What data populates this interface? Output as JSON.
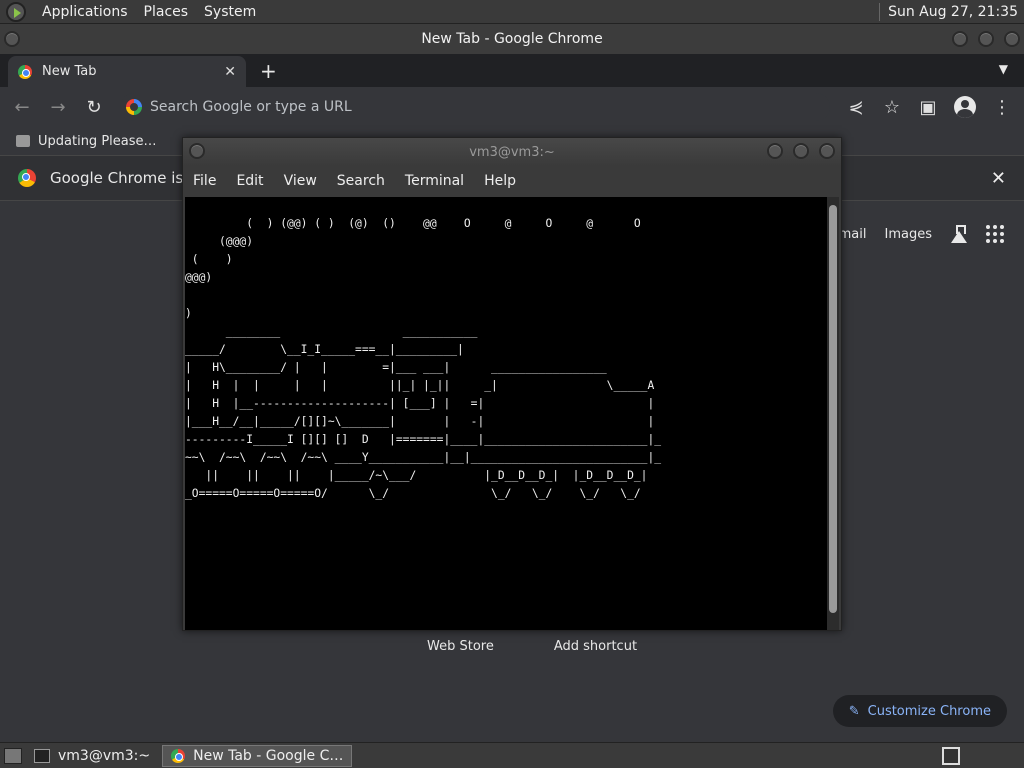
{
  "system_panel": {
    "menus": [
      "Applications",
      "Places",
      "System"
    ],
    "clock": "Sun Aug 27, 21:35"
  },
  "chrome": {
    "window_title": "New Tab - Google Chrome",
    "tab": {
      "title": "New Tab",
      "close": "✕"
    },
    "omnibox_placeholder": "Search Google or type a URL",
    "bookmark": "Updating Please…",
    "infobar_text": "Google Chrome isn't y",
    "ntp": {
      "links": [
        "mail",
        "Images"
      ],
      "shortcuts": [
        "Web Store",
        "Add shortcut"
      ],
      "customize": "Customize Chrome"
    }
  },
  "terminal": {
    "title": "vm3@vm3:~",
    "menu": [
      "File",
      "Edit",
      "View",
      "Search",
      "Terminal",
      "Help"
    ],
    "output": "         (  ) (@@) ( )  (@)  ()    @@    O     @     O     @      O\n     (@@@)\n (    )\n@@@)\n\n)\n      ________                  ___________\n_____/        \\__I_I_____===__|_________|\n|   H\\________/ |   |        =|___ ___|      _________________\n|   H  |  |     |   |         ||_| |_||     _|                \\_____A\n|   H  |__--------------------| [___] |   =|                        |\n|___H__/__|_____/[][]~\\_______|       |   -|                        |\n---------I_____I [][] []  D   |=======|____|________________________|_\n~~\\  /~~\\  /~~\\  /~~\\ ____Y___________|__|__________________________|_\n   ||    ||    ||    |_____/~\\___/          |_D__D__D_|  |_D__D__D_|\n_O=====O=====O=====O/      \\_/               \\_/   \\_/    \\_/   \\_/"
  },
  "taskbar": {
    "items": [
      "vm3@vm3:~",
      "New Tab - Google C…"
    ]
  },
  "colors": {
    "panel_bg": "#3a3a3a",
    "chrome_toolbar": "#35363a",
    "terminal_bg": "#000000",
    "accent_link": "#8ab4f8"
  }
}
